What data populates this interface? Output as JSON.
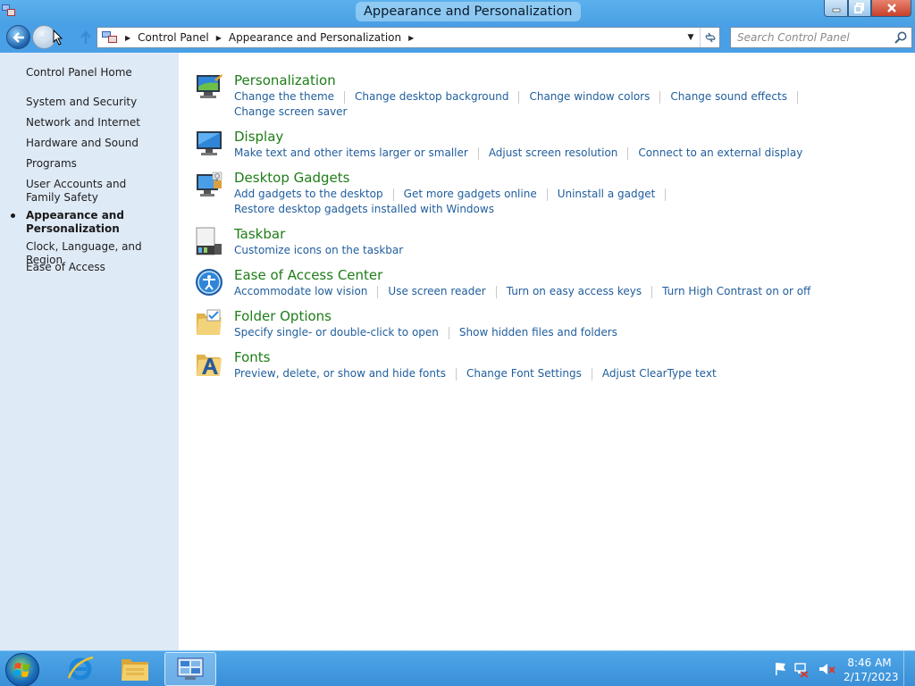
{
  "window": {
    "title": "Appearance and Personalization"
  },
  "address": {
    "crumbs": [
      "Control Panel",
      "Appearance and Personalization"
    ]
  },
  "search": {
    "placeholder": "Search Control Panel"
  },
  "sidebar": {
    "home": "Control Panel Home",
    "items": [
      "System and Security",
      "Network and Internet",
      "Hardware and Sound",
      "Programs",
      "User Accounts and Family Safety",
      "Appearance and Personalization",
      "Clock, Language, and Region",
      "Ease of Access"
    ],
    "current_index": 5
  },
  "categories": [
    {
      "title": "Personalization",
      "icon": "personalization-icon",
      "rows": [
        [
          "Change the theme",
          "Change desktop background",
          "Change window colors",
          "Change sound effects"
        ],
        [
          "Change screen saver"
        ]
      ]
    },
    {
      "title": "Display",
      "icon": "display-icon",
      "rows": [
        [
          "Make text and other items larger or smaller",
          "Adjust screen resolution",
          "Connect to an external display"
        ]
      ]
    },
    {
      "title": "Desktop Gadgets",
      "icon": "gadgets-icon",
      "rows": [
        [
          "Add gadgets to the desktop",
          "Get more gadgets online",
          "Uninstall a gadget"
        ],
        [
          "Restore desktop gadgets installed with Windows"
        ]
      ]
    },
    {
      "title": "Taskbar",
      "icon": "taskbar-icon",
      "rows": [
        [
          "Customize icons on the taskbar"
        ]
      ]
    },
    {
      "title": "Ease of Access Center",
      "icon": "ease-of-access-icon",
      "rows": [
        [
          "Accommodate low vision",
          "Use screen reader",
          "Turn on easy access keys",
          "Turn High Contrast on or off"
        ]
      ]
    },
    {
      "title": "Folder Options",
      "icon": "folder-options-icon",
      "rows": [
        [
          "Specify single- or double-click to open",
          "Show hidden files and folders"
        ]
      ]
    },
    {
      "title": "Fonts",
      "icon": "fonts-icon",
      "rows": [
        [
          "Preview, delete, or show and hide fonts",
          "Change Font Settings",
          "Adjust ClearType text"
        ]
      ]
    }
  ],
  "taskbar": {
    "time": "8:46 AM",
    "date": "2/17/2023"
  },
  "colors": {
    "link": "#1f5d9c",
    "category_title": "#1e7d18",
    "sidebar_bg": "#dfeaf7",
    "frame": "#4aa0e6"
  }
}
